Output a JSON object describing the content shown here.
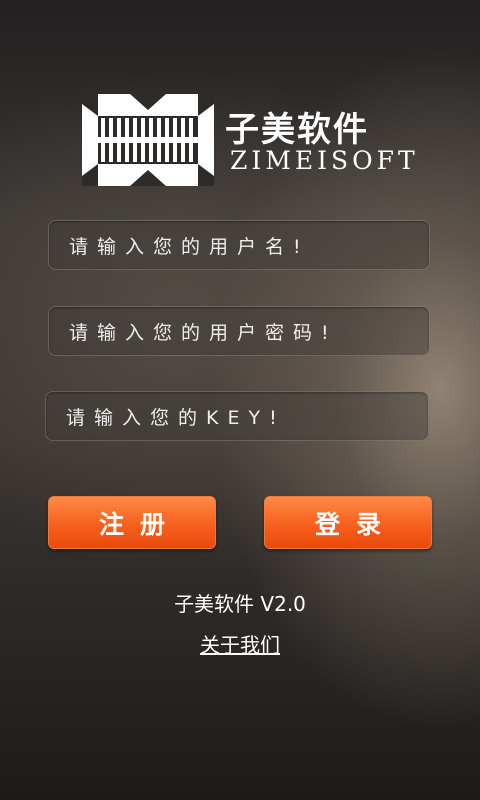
{
  "logo": {
    "title": "子美软件",
    "subtitle": "ZIMEISOFT"
  },
  "form": {
    "username_placeholder": "请输入您的用户名!",
    "password_placeholder": "请输入您的用户密码!",
    "key_placeholder": "请输入您的KEY!"
  },
  "buttons": {
    "register_label": "注册",
    "login_label": "登录"
  },
  "footer": {
    "version": "子美软件 V2.0",
    "about_link": "关于我们"
  },
  "colors": {
    "accent": "#f86422"
  }
}
